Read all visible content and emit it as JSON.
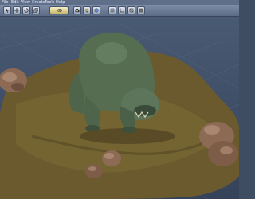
{
  "window": {
    "menu": [
      "File",
      "Edit",
      "View",
      "Create",
      "Tools",
      "Help"
    ]
  },
  "toolbar": {
    "buttons": [
      {
        "name": "select-tool",
        "icon": "arrow-icon",
        "active": false
      },
      {
        "name": "move-tool",
        "icon": "move-icon",
        "active": false
      },
      {
        "name": "rotate-tool",
        "icon": "rotate-icon",
        "active": false
      },
      {
        "name": "scale-tool",
        "icon": "scale-icon",
        "active": false
      },
      {
        "name": "view-tool",
        "icon": "eye-icon",
        "active": true
      },
      {
        "name": "camera-tool",
        "icon": "camera-icon",
        "active": false
      },
      {
        "name": "light-tool",
        "icon": "light-icon",
        "active": false
      },
      {
        "name": "render-tool",
        "icon": "render-icon",
        "active": false
      }
    ]
  },
  "viewport": {
    "status_text": "~~~~~~~~~~ ~~ ~~ ~"
  },
  "colors": {
    "background": "#3f4d63",
    "terrain": "#6b5a2e",
    "creature": "#566d52",
    "rocks": "#8c6a54"
  }
}
